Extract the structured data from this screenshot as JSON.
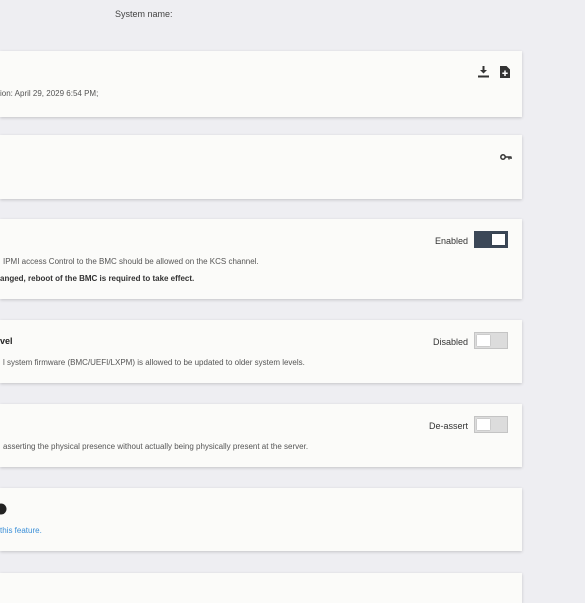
{
  "header": {
    "system_name_label": "System name:"
  },
  "cards": {
    "backup": {
      "text": "ion: April 29, 2029 6:54 PM;"
    },
    "ipmi": {
      "toggle_label": "Enabled",
      "toggle_on": true,
      "line1": "IPMI access Control to the BMC should be allowed on the KCS channel.",
      "line2": "anged, reboot of the BMC is required to take effect."
    },
    "downgrade": {
      "title_fragment": "vel",
      "toggle_label": "Disabled",
      "toggle_on": false,
      "line1": "l system firmware (BMC/UEFI/LXPM) is allowed to be updated to older system levels."
    },
    "presence": {
      "toggle_label": "De-assert",
      "toggle_on": false,
      "line1": "asserting the physical presence without actually being physically present at the server."
    },
    "feature": {
      "link_text": "this feature."
    }
  },
  "icons": {
    "download": "download-icon",
    "file_add": "file-add-icon",
    "key": "key-icon",
    "help": "help-circle-icon"
  },
  "colors": {
    "toggle_on": "#3b4757",
    "link": "#3a8fd8",
    "background": "#eeeef2"
  }
}
